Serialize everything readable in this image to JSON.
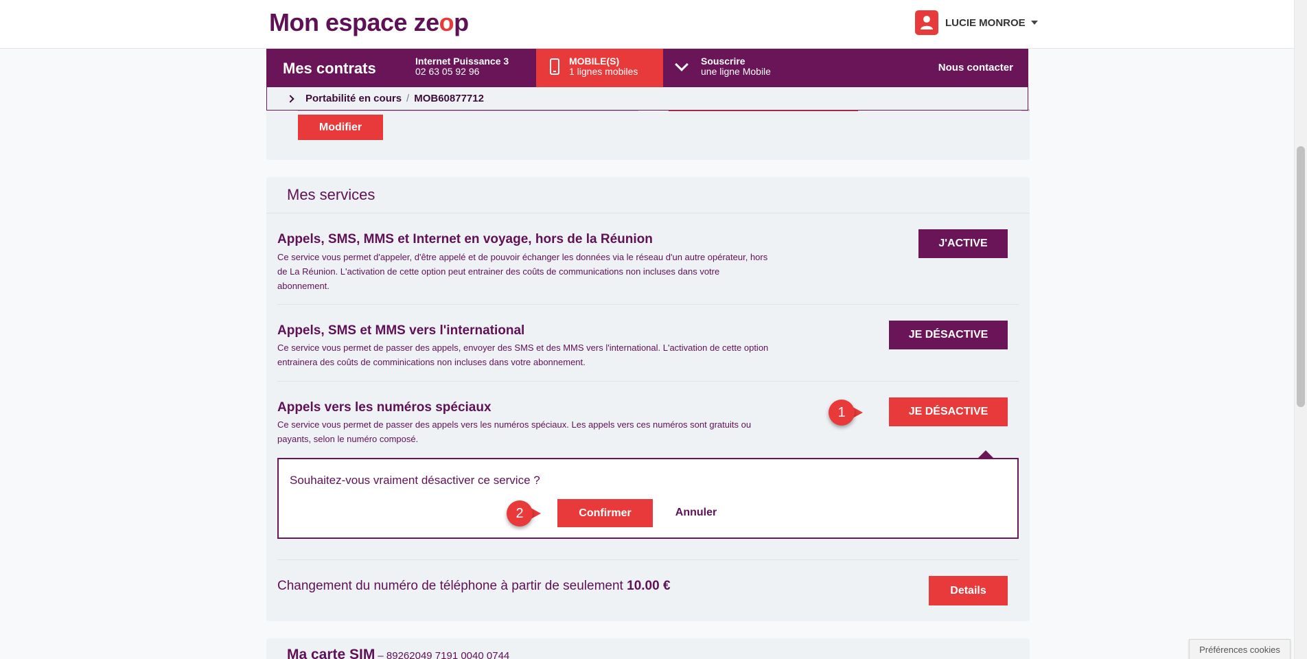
{
  "header": {
    "logo_main": "Mon espace ze",
    "logo_o": "o",
    "logo_p": "p",
    "user_name": "LUCIE MONROE",
    "colors": {
      "brand_purple": "#6a1558",
      "accent_red": "#e83a3a",
      "card_bg": "#eef2f5"
    }
  },
  "nav": {
    "title": "Mes contrats",
    "internet": {
      "name": "Internet Puissance 3",
      "number": "02 63 05 92 96"
    },
    "mobile": {
      "name": "MOBILE(S)",
      "count": "1 lignes mobiles",
      "icon": "phone-icon"
    },
    "souscrire": {
      "name": "Souscrire",
      "sub": "une ligne Mobile",
      "icon": "chevron-down-icon"
    },
    "contact": "Nous contacter"
  },
  "breadcrumb": {
    "item1": "Portabilité en cours",
    "separator": "/",
    "item2": "MOB60877712"
  },
  "top_card": {
    "modify_label": "Modifier"
  },
  "services": {
    "title": "Mes services",
    "items": [
      {
        "title": "Appels, SMS, MMS et Internet en voyage, hors de la Réunion",
        "desc": "Ce service vous permet d'appeler, d'être appelé et de pouvoir échanger les données via le réseau d'un autre opérateur, hors de La Réunion. L'activation de cette option peut entrainer des coûts de communications non incluses dans votre abonnement.",
        "button": "J'ACTIVE"
      },
      {
        "title": "Appels, SMS et MMS vers l'international",
        "desc": "Ce service vous permet de passer des appels, envoyer des SMS et des MMS vers l'international. L'activation de cette option entrainera des coûts de comminications non incluses dans votre abonnement.",
        "button": "JE DÉSACTIVE"
      },
      {
        "title": "Appels vers les numéros spéciaux",
        "desc": "Ce service vous permet de passer des appels vers les numéros spéciaux. Les appels vers ces numéros sont gratuits ou payants, selon le numéro composé.",
        "button": "JE DÉSACTIVE"
      }
    ],
    "confirm": {
      "question": "Souhaitez-vous vraiment désactiver ce service ?",
      "confirm_label": "Confirmer",
      "cancel_label": "Annuler"
    },
    "change_number": {
      "text": "Changement du numéro de téléphone à partir de seulement",
      "price": "10.00 €",
      "button": "Details"
    }
  },
  "markers": {
    "step1": "1",
    "step2": "2"
  },
  "sim": {
    "title": "Ma carte SIM",
    "number": "– 89262049 7191 0040 0744"
  },
  "cookie": {
    "label": "Préférences cookies"
  }
}
